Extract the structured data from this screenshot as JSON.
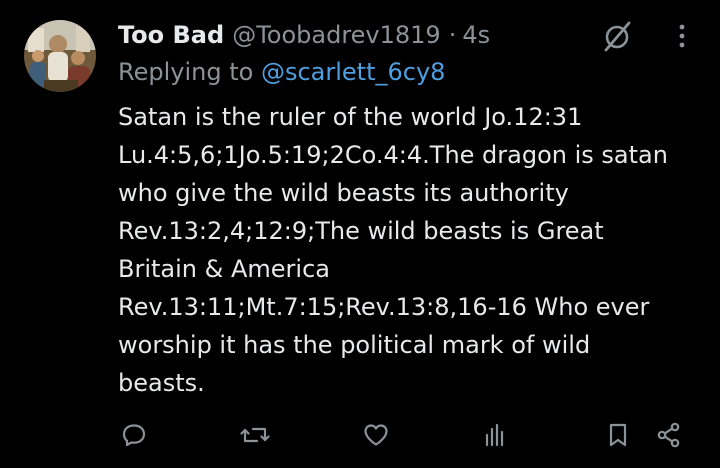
{
  "tweet": {
    "display_name": "Too Bad",
    "handle": "@Toobadrev1819",
    "separator": "·",
    "time": "4s",
    "replying_prefix": "Replying to",
    "replying_to": "@scarlett_6cy8",
    "body_lines": [
      "Satan is the ruler of the world Jo.12:31",
      "Lu.4:5,6;1Jo.5:19;2Co.4:4.The dragon is satan",
      "who give the wild beasts its authority",
      "Rev.13:2,4;12:9;The wild beasts is Great",
      "Britain & America",
      "Rev.13:11;Mt.7:15;Rev.13:8,16-16 Who ever",
      "worship it has the political mark of wild",
      "beasts."
    ]
  },
  "icons": {
    "grok": "grok-icon",
    "more": "more-icon",
    "reply": "reply-icon",
    "retweet": "retweet-icon",
    "like": "heart-icon",
    "views": "views-icon",
    "bookmark": "bookmark-icon",
    "share": "share-icon"
  },
  "colors": {
    "background": "#000000",
    "text": "#e7e9ea",
    "muted": "#8b9298",
    "link": "#4f9fe0"
  }
}
